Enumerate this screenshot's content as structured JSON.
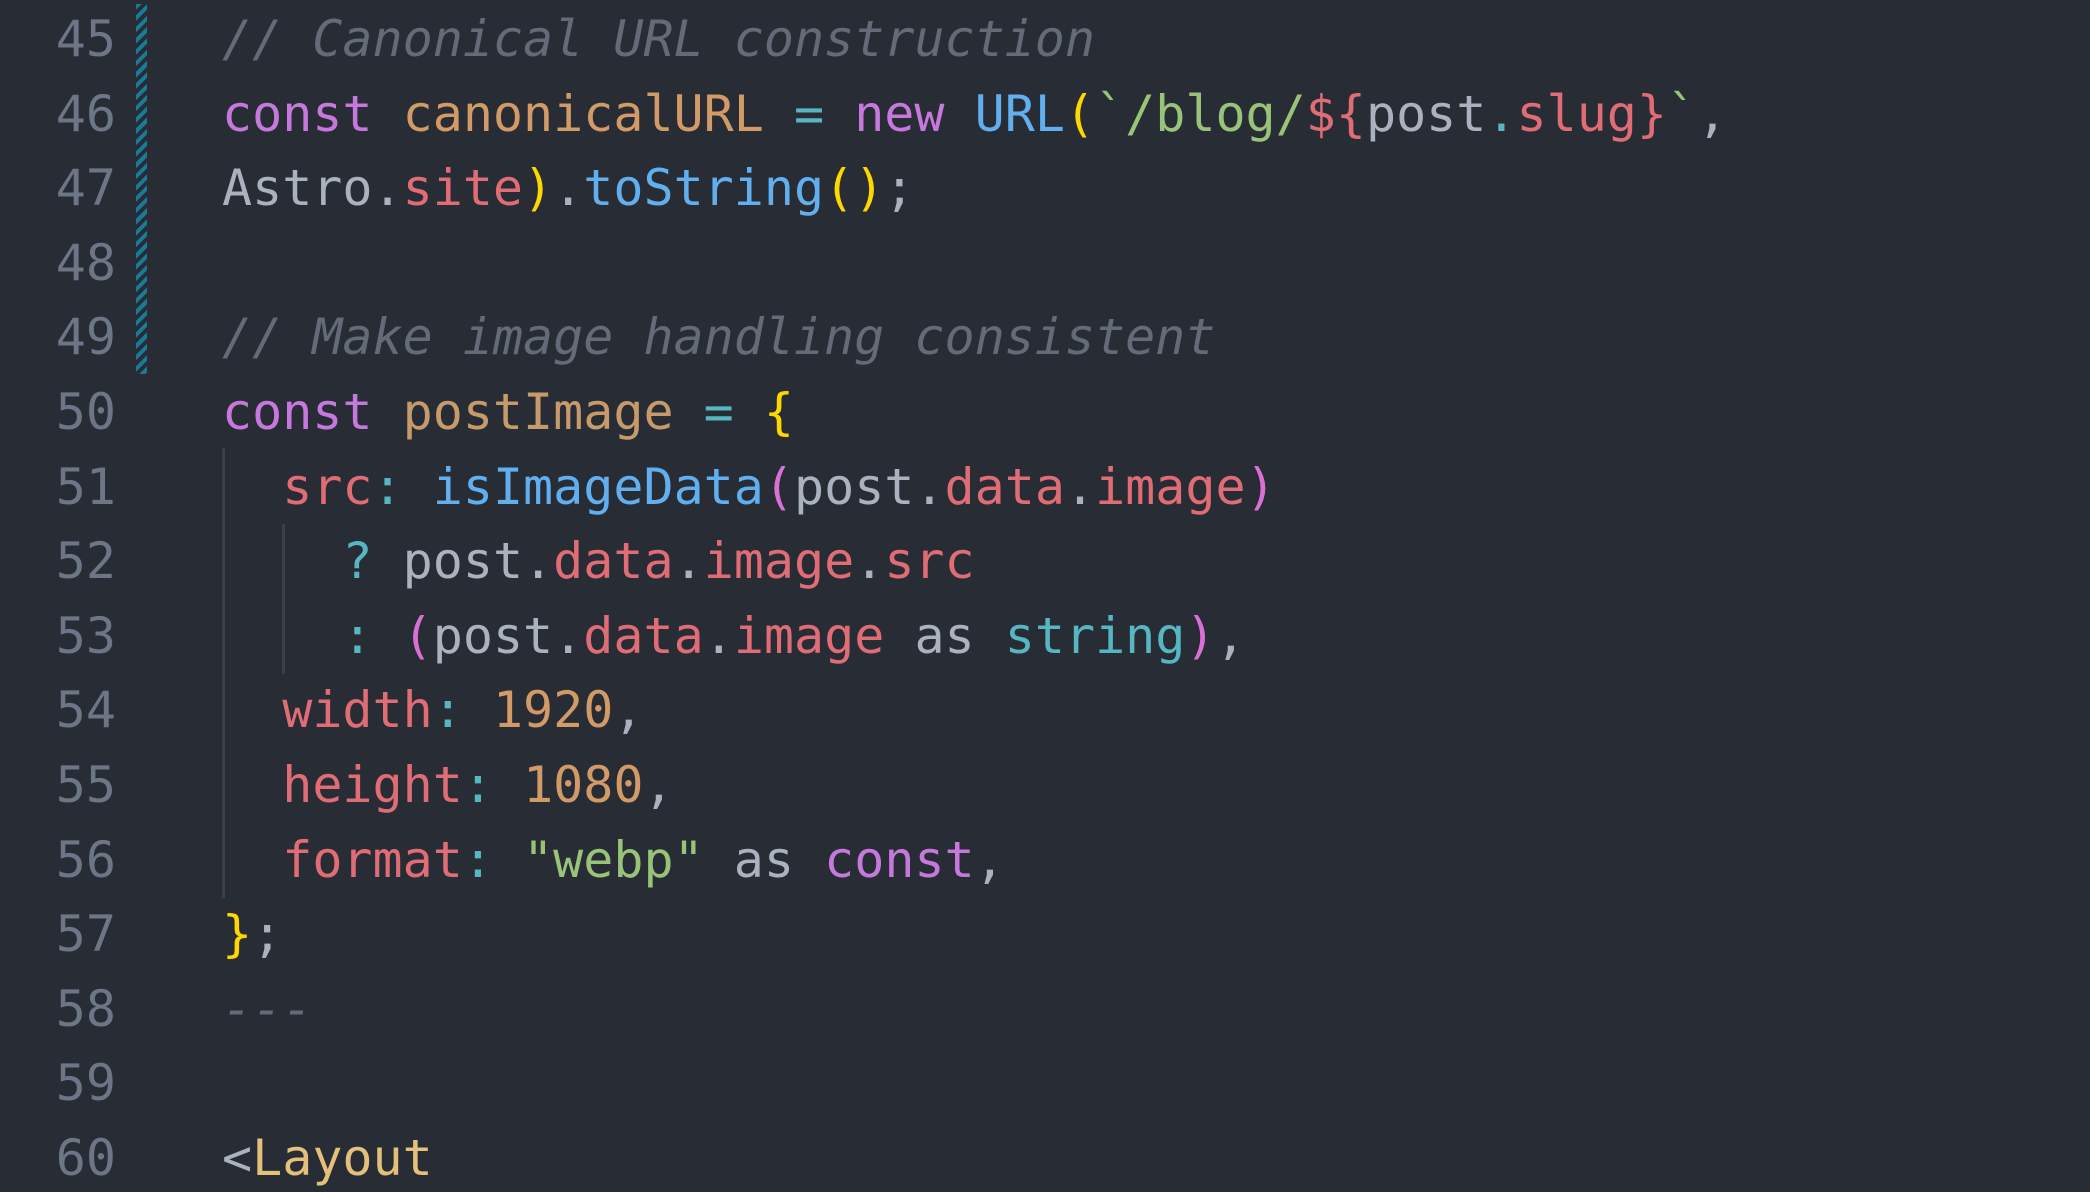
{
  "editor": {
    "line_numbers": [
      "45",
      "46",
      "47",
      "48",
      "49",
      "50",
      "51",
      "52",
      "53",
      "54",
      "55",
      "56",
      "57",
      "58",
      "59",
      "60"
    ],
    "lines": [
      [
        {
          "t": "// Canonical URL construction",
          "c": "cm"
        }
      ],
      [
        {
          "t": "const",
          "c": "kw"
        },
        {
          "t": " ",
          "c": "plain"
        },
        {
          "t": "canonicalURL",
          "c": "var"
        },
        {
          "t": " ",
          "c": "plain"
        },
        {
          "t": "=",
          "c": "op"
        },
        {
          "t": " ",
          "c": "plain"
        },
        {
          "t": "new",
          "c": "kw"
        },
        {
          "t": " ",
          "c": "plain"
        },
        {
          "t": "URL",
          "c": "fn"
        },
        {
          "t": "(",
          "c": "br1"
        },
        {
          "t": "`/blog/",
          "c": "str"
        },
        {
          "t": "${",
          "c": "tpl"
        },
        {
          "t": "post",
          "c": "plain"
        },
        {
          "t": ".",
          "c": "op"
        },
        {
          "t": "slug",
          "c": "prop"
        },
        {
          "t": "}",
          "c": "tpl"
        },
        {
          "t": "`",
          "c": "str"
        },
        {
          "t": ",",
          "c": "plain"
        }
      ],
      [
        {
          "t": "Astro",
          "c": "plain"
        },
        {
          "t": ".",
          "c": "plain"
        },
        {
          "t": "site",
          "c": "prop"
        },
        {
          "t": ")",
          "c": "br1"
        },
        {
          "t": ".",
          "c": "plain"
        },
        {
          "t": "toString",
          "c": "fn"
        },
        {
          "t": "()",
          "c": "br1"
        },
        {
          "t": ";",
          "c": "plain"
        }
      ],
      [],
      [
        {
          "t": "// Make image handling consistent",
          "c": "cm"
        }
      ],
      [
        {
          "t": "const",
          "c": "kw"
        },
        {
          "t": " ",
          "c": "plain"
        },
        {
          "t": "postImage",
          "c": "var2"
        },
        {
          "t": " ",
          "c": "plain"
        },
        {
          "t": "=",
          "c": "op"
        },
        {
          "t": " ",
          "c": "plain"
        },
        {
          "t": "{",
          "c": "br1"
        }
      ],
      [
        {
          "t": "  ",
          "c": "plain"
        },
        {
          "t": "src",
          "c": "prop"
        },
        {
          "t": ":",
          "c": "op"
        },
        {
          "t": " ",
          "c": "plain"
        },
        {
          "t": "isImageData",
          "c": "fn"
        },
        {
          "t": "(",
          "c": "br2"
        },
        {
          "t": "post",
          "c": "plain"
        },
        {
          "t": ".",
          "c": "plain"
        },
        {
          "t": "data",
          "c": "prop"
        },
        {
          "t": ".",
          "c": "plain"
        },
        {
          "t": "image",
          "c": "prop"
        },
        {
          "t": ")",
          "c": "br2"
        }
      ],
      [
        {
          "t": "    ",
          "c": "plain"
        },
        {
          "t": "?",
          "c": "op"
        },
        {
          "t": " ",
          "c": "plain"
        },
        {
          "t": "post",
          "c": "plain"
        },
        {
          "t": ".",
          "c": "plain"
        },
        {
          "t": "data",
          "c": "prop"
        },
        {
          "t": ".",
          "c": "plain"
        },
        {
          "t": "image",
          "c": "prop"
        },
        {
          "t": ".",
          "c": "plain"
        },
        {
          "t": "src",
          "c": "prop"
        }
      ],
      [
        {
          "t": "    ",
          "c": "plain"
        },
        {
          "t": ":",
          "c": "op"
        },
        {
          "t": " ",
          "c": "plain"
        },
        {
          "t": "(",
          "c": "br2"
        },
        {
          "t": "post",
          "c": "plain"
        },
        {
          "t": ".",
          "c": "plain"
        },
        {
          "t": "data",
          "c": "prop"
        },
        {
          "t": ".",
          "c": "plain"
        },
        {
          "t": "image",
          "c": "prop"
        },
        {
          "t": " ",
          "c": "plain"
        },
        {
          "t": "as",
          "c": "plain"
        },
        {
          "t": " ",
          "c": "plain"
        },
        {
          "t": "string",
          "c": "type"
        },
        {
          "t": ")",
          "c": "br2"
        },
        {
          "t": ",",
          "c": "plain"
        }
      ],
      [
        {
          "t": "  ",
          "c": "plain"
        },
        {
          "t": "width",
          "c": "prop"
        },
        {
          "t": ":",
          "c": "op"
        },
        {
          "t": " ",
          "c": "plain"
        },
        {
          "t": "1920",
          "c": "num"
        },
        {
          "t": ",",
          "c": "plain"
        }
      ],
      [
        {
          "t": "  ",
          "c": "plain"
        },
        {
          "t": "height",
          "c": "prop"
        },
        {
          "t": ":",
          "c": "op"
        },
        {
          "t": " ",
          "c": "plain"
        },
        {
          "t": "1080",
          "c": "num"
        },
        {
          "t": ",",
          "c": "plain"
        }
      ],
      [
        {
          "t": "  ",
          "c": "plain"
        },
        {
          "t": "format",
          "c": "prop"
        },
        {
          "t": ":",
          "c": "op"
        },
        {
          "t": " ",
          "c": "plain"
        },
        {
          "t": "\"webp\"",
          "c": "str"
        },
        {
          "t": " ",
          "c": "plain"
        },
        {
          "t": "as",
          "c": "plain"
        },
        {
          "t": " ",
          "c": "plain"
        },
        {
          "t": "const",
          "c": "kw"
        },
        {
          "t": ",",
          "c": "plain"
        }
      ],
      [
        {
          "t": "}",
          "c": "br1"
        },
        {
          "t": ";",
          "c": "plain"
        }
      ],
      [
        {
          "t": "---",
          "c": "cm"
        }
      ],
      [],
      [
        {
          "t": "<",
          "c": "plain"
        },
        {
          "t": "Layout",
          "c": "tag"
        }
      ]
    ]
  },
  "colors": {
    "background": "#282c34",
    "line_number": "#6c7687",
    "comment": "#646b78",
    "keyword": "#c678dd",
    "function": "#61afef",
    "string": "#98c379",
    "property": "#e06c75",
    "number": "#d19a66",
    "bracket_gold": "#ffd700",
    "bracket_magenta": "#da70d6",
    "git_modified": "#1a7a99"
  }
}
